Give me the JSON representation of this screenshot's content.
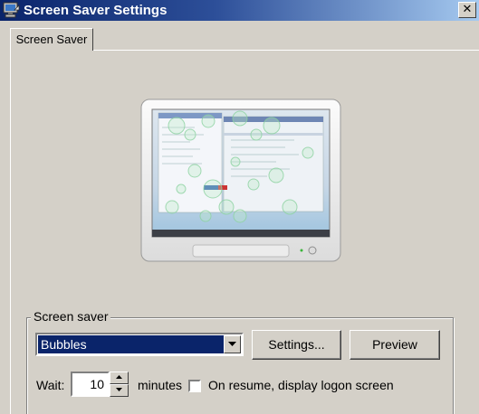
{
  "window": {
    "title": "Screen Saver Settings",
    "close_glyph": "✕"
  },
  "tabs": [
    {
      "label": "Screen Saver",
      "selected": true
    }
  ],
  "preview_monitor": {
    "icon": "monitor-preview",
    "screen_content": "Bubbles screen saver over desktop"
  },
  "screen_saver_group": {
    "label": "Screen saver",
    "selected_saver": "Bubbles",
    "settings_label": "Settings...",
    "preview_label": "Preview",
    "wait_label": "Wait:",
    "wait_value": "10",
    "minutes_label": "minutes",
    "resume_label": "On resume, display logon screen",
    "resume_checked": false
  },
  "colors": {
    "face": "#d4d0c8",
    "title_start": "#0a246a",
    "title_end": "#a6caf0",
    "selection": "#0a246a"
  }
}
